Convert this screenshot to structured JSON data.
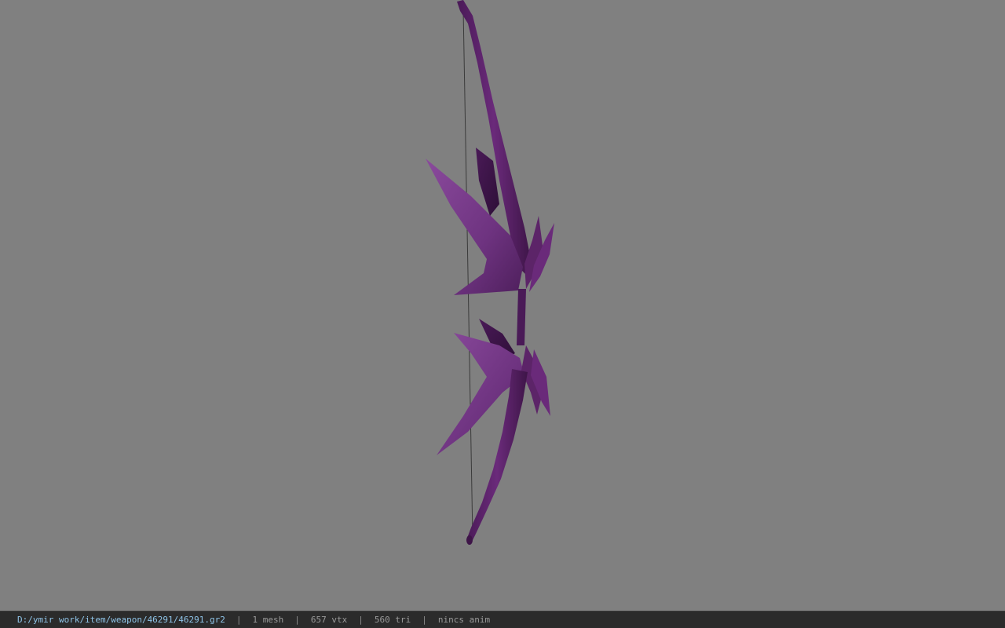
{
  "status_bar": {
    "file_path": "D:/ymir work/item/weapon/46291/46291.gr2",
    "separator": "|",
    "mesh_count": "1 mesh",
    "vertex_count": "657 vtx",
    "triangle_count": "560 tri",
    "animation": "nincs anim"
  },
  "viewport": {
    "background_color": "#808080",
    "model_colors": {
      "light": "#7b3b8c",
      "mid": "#5c2468",
      "dark": "#3e1548",
      "string": "#3a3a3a"
    }
  }
}
